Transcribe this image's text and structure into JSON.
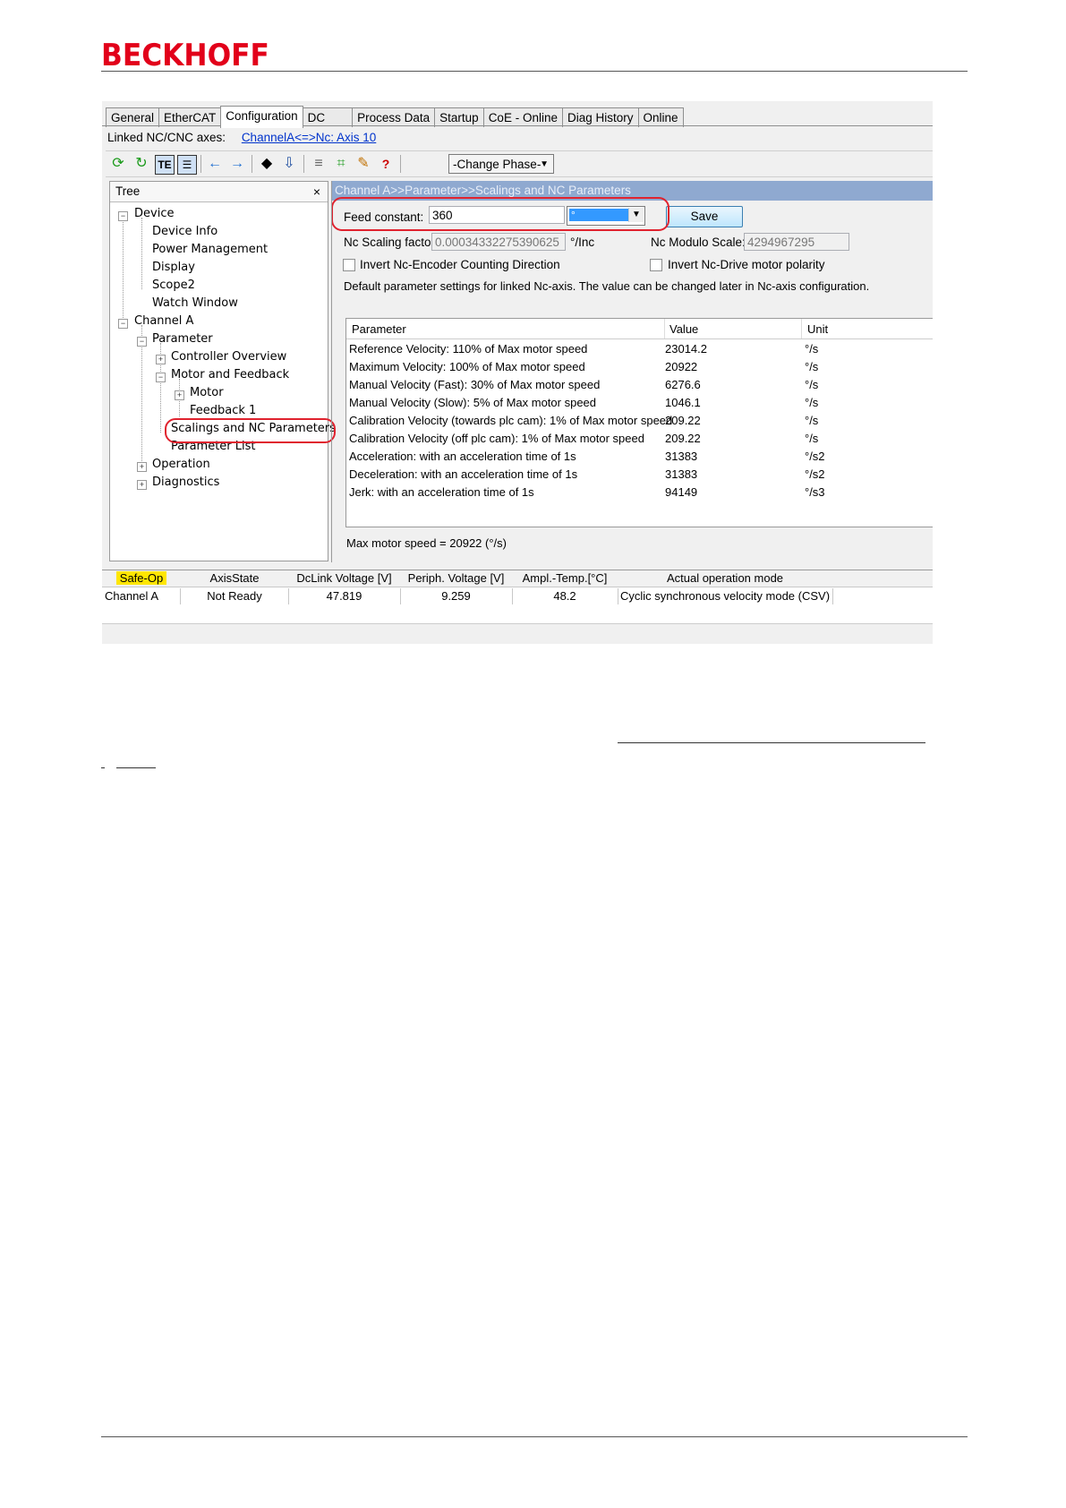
{
  "brand": {
    "logo": "BECKHOFF",
    "color": "#e2001a"
  },
  "tabs": [
    "General",
    "EtherCAT",
    "Configuration",
    "DC",
    "Process Data",
    "Startup",
    "CoE - Online",
    "Diag History",
    "Online"
  ],
  "linked": {
    "label": "Linked NC/CNC axes:",
    "link": "ChannelA<=>Nc: Axis 10"
  },
  "toolbar": {
    "phase_label": "-Change Phase-"
  },
  "tree": {
    "title": "Tree",
    "close": "×",
    "nodes": [
      "Device",
      "Device Info",
      "Power Management",
      "Display",
      "Scope2",
      "Watch Window",
      "Channel A",
      "Parameter",
      "Controller Overview",
      "Motor and Feedback",
      "Motor",
      "Feedback 1",
      "Scalings and NC Parameters",
      "Parameter List",
      "Operation",
      "Diagnostics"
    ]
  },
  "main": {
    "header": "Channel A>>Parameter>>Scalings and NC Parameters",
    "feed_constant_label": "Feed constant:",
    "feed_constant_value": "360",
    "unit_value": "°",
    "save_label": "Save",
    "nc_scaling_label": "Nc Scaling factor:",
    "nc_scaling_value": "0.00034332275390625",
    "nc_scaling_unit": "°/Inc",
    "nc_modulo_label": "Nc Modulo Scale:",
    "nc_modulo_value": "4294967295",
    "invert_encoder_label": "Invert Nc-Encoder Counting Direction",
    "invert_drive_label": "Invert Nc-Drive motor polarity",
    "default_note": "Default parameter settings for linked Nc-axis. The value can be changed later in Nc-axis configuration.",
    "table": {
      "columns": [
        "Parameter",
        "Value",
        "Unit"
      ],
      "rows": [
        [
          "Reference Velocity: 110% of Max motor speed",
          "23014.2",
          "°/s"
        ],
        [
          "Maximum Velocity: 100% of Max motor speed",
          "20922",
          "°/s"
        ],
        [
          "Manual Velocity (Fast): 30% of Max motor speed",
          "6276.6",
          "°/s"
        ],
        [
          "Manual Velocity (Slow): 5% of Max motor speed",
          "1046.1",
          "°/s"
        ],
        [
          "Calibration Velocity (towards plc cam): 1% of Max motor speed",
          "209.22",
          "°/s"
        ],
        [
          "Calibration Velocity (off plc cam): 1% of Max motor speed",
          "209.22",
          "°/s"
        ],
        [
          "Acceleration: with an acceleration time of 1s",
          "31383",
          "°/s2"
        ],
        [
          "Deceleration: with an acceleration time of 1s",
          "31383",
          "°/s2"
        ],
        [
          "Jerk: with an acceleration time of 1s",
          "94149",
          "°/s3"
        ]
      ]
    },
    "max_speed_note": "Max motor speed = 20922 (°/s)"
  },
  "status": {
    "columns": [
      "Safe-Op",
      "AxisState",
      "DcLink Voltage [V]",
      "Periph. Voltage [V]",
      "Ampl.-Temp.[°C]",
      "Actual operation mode"
    ],
    "values": [
      "Channel A",
      "Not Ready",
      "47.819",
      "9.259",
      "48.2",
      "Cyclic synchronous velocity mode (CSV)"
    ]
  },
  "colors": {
    "highlight_ring": "#e0222e",
    "header_bar": "#8fa9d0",
    "safe_op_bg": "#ffe600"
  }
}
